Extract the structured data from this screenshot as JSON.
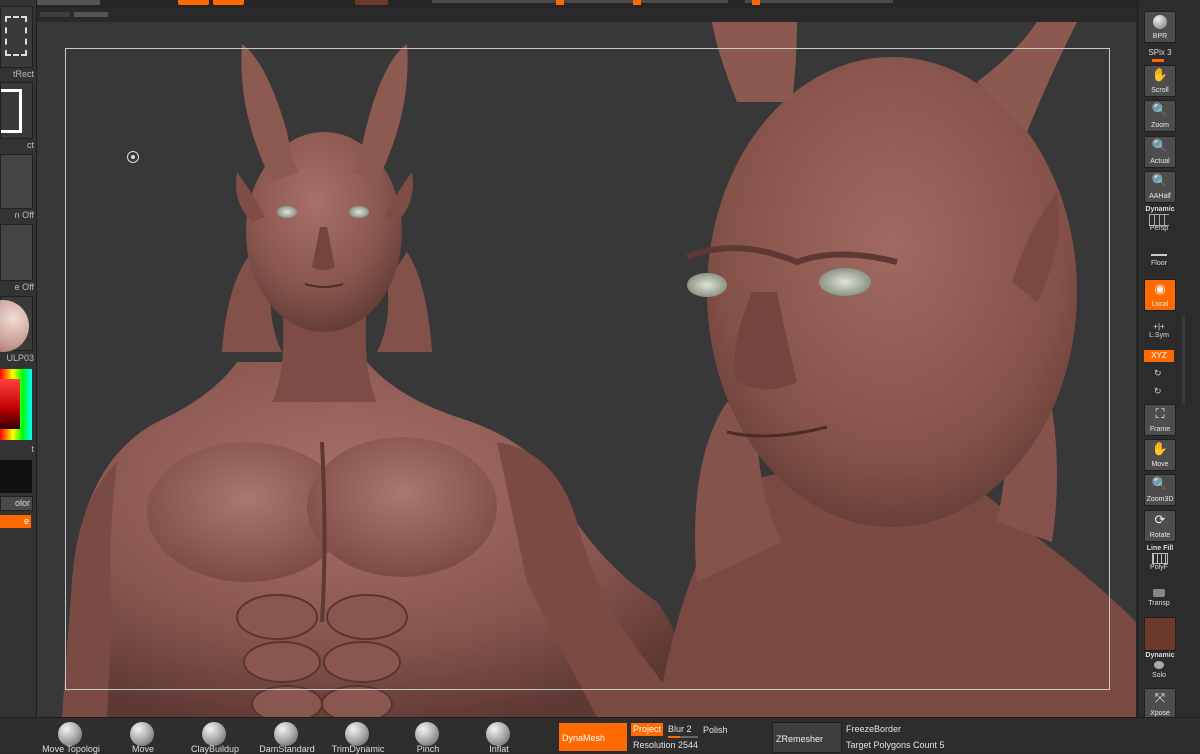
{
  "left_panel": {
    "tiles": [
      {
        "label": "tRect"
      },
      {
        "label": "ct"
      },
      {
        "label": "n Off"
      },
      {
        "label": "e Off"
      },
      {
        "label": "ULP03"
      }
    ],
    "color_labels": [
      "t",
      "olor"
    ],
    "orange_label": "e"
  },
  "right_panel": {
    "spix_label": "SPix 3",
    "dynamic_label": "Dynamic",
    "line_fill_label": "Line Fill",
    "dynamic2_label": "Dynamic",
    "buttons": [
      {
        "label": "BPR",
        "icon": "sphere-icon"
      },
      {
        "label": "Scroll",
        "icon": "hand-icon"
      },
      {
        "label": "Zoom",
        "icon": "magnifier-icon"
      },
      {
        "label": "Actual",
        "icon": "magnifier-icon"
      },
      {
        "label": "AAHalf",
        "icon": "magnifier-icon"
      },
      {
        "label": "Persp",
        "icon": "grid-icon"
      },
      {
        "label": "Floor",
        "icon": "floor-icon"
      },
      {
        "label": "Local",
        "icon": "local-icon",
        "active": true
      },
      {
        "label": "L.Sym",
        "icon": "symmetry-icon"
      },
      {
        "label": "XYZ",
        "icon": "xyz-icon",
        "active": true
      },
      {
        "label": "Frame",
        "icon": "frame-icon"
      },
      {
        "label": "Move",
        "icon": "hand-icon"
      },
      {
        "label": "Zoom3D",
        "icon": "magnifier-icon"
      },
      {
        "label": "Rotate",
        "icon": "rotate-icon"
      },
      {
        "label": "PolyF",
        "icon": "grid-icon"
      },
      {
        "label": "Transp",
        "icon": "transp-icon"
      },
      {
        "label": "Solo",
        "icon": "solo-icon"
      },
      {
        "label": "Xpose",
        "icon": "xpose-icon"
      }
    ]
  },
  "bottom_bar": {
    "brushes": [
      "Move Topologi",
      "Move",
      "ClayBuildup",
      "DamStandard",
      "TrimDynamic",
      "Pinch",
      "Inflat"
    ],
    "dynamesh_label": "DynaMesh",
    "project_label": "Project",
    "blur_label": "Blur 2",
    "polish_label": "Polish",
    "resolution_label": "Resolution 2544",
    "zremesher_label": "ZRemesher",
    "freeze_label": "FreezeBorder",
    "target_label": "Target Polygons Count 5"
  },
  "colors": {
    "accent": "#ff6a00",
    "skin": "#8e5a52",
    "background": "#383838"
  }
}
